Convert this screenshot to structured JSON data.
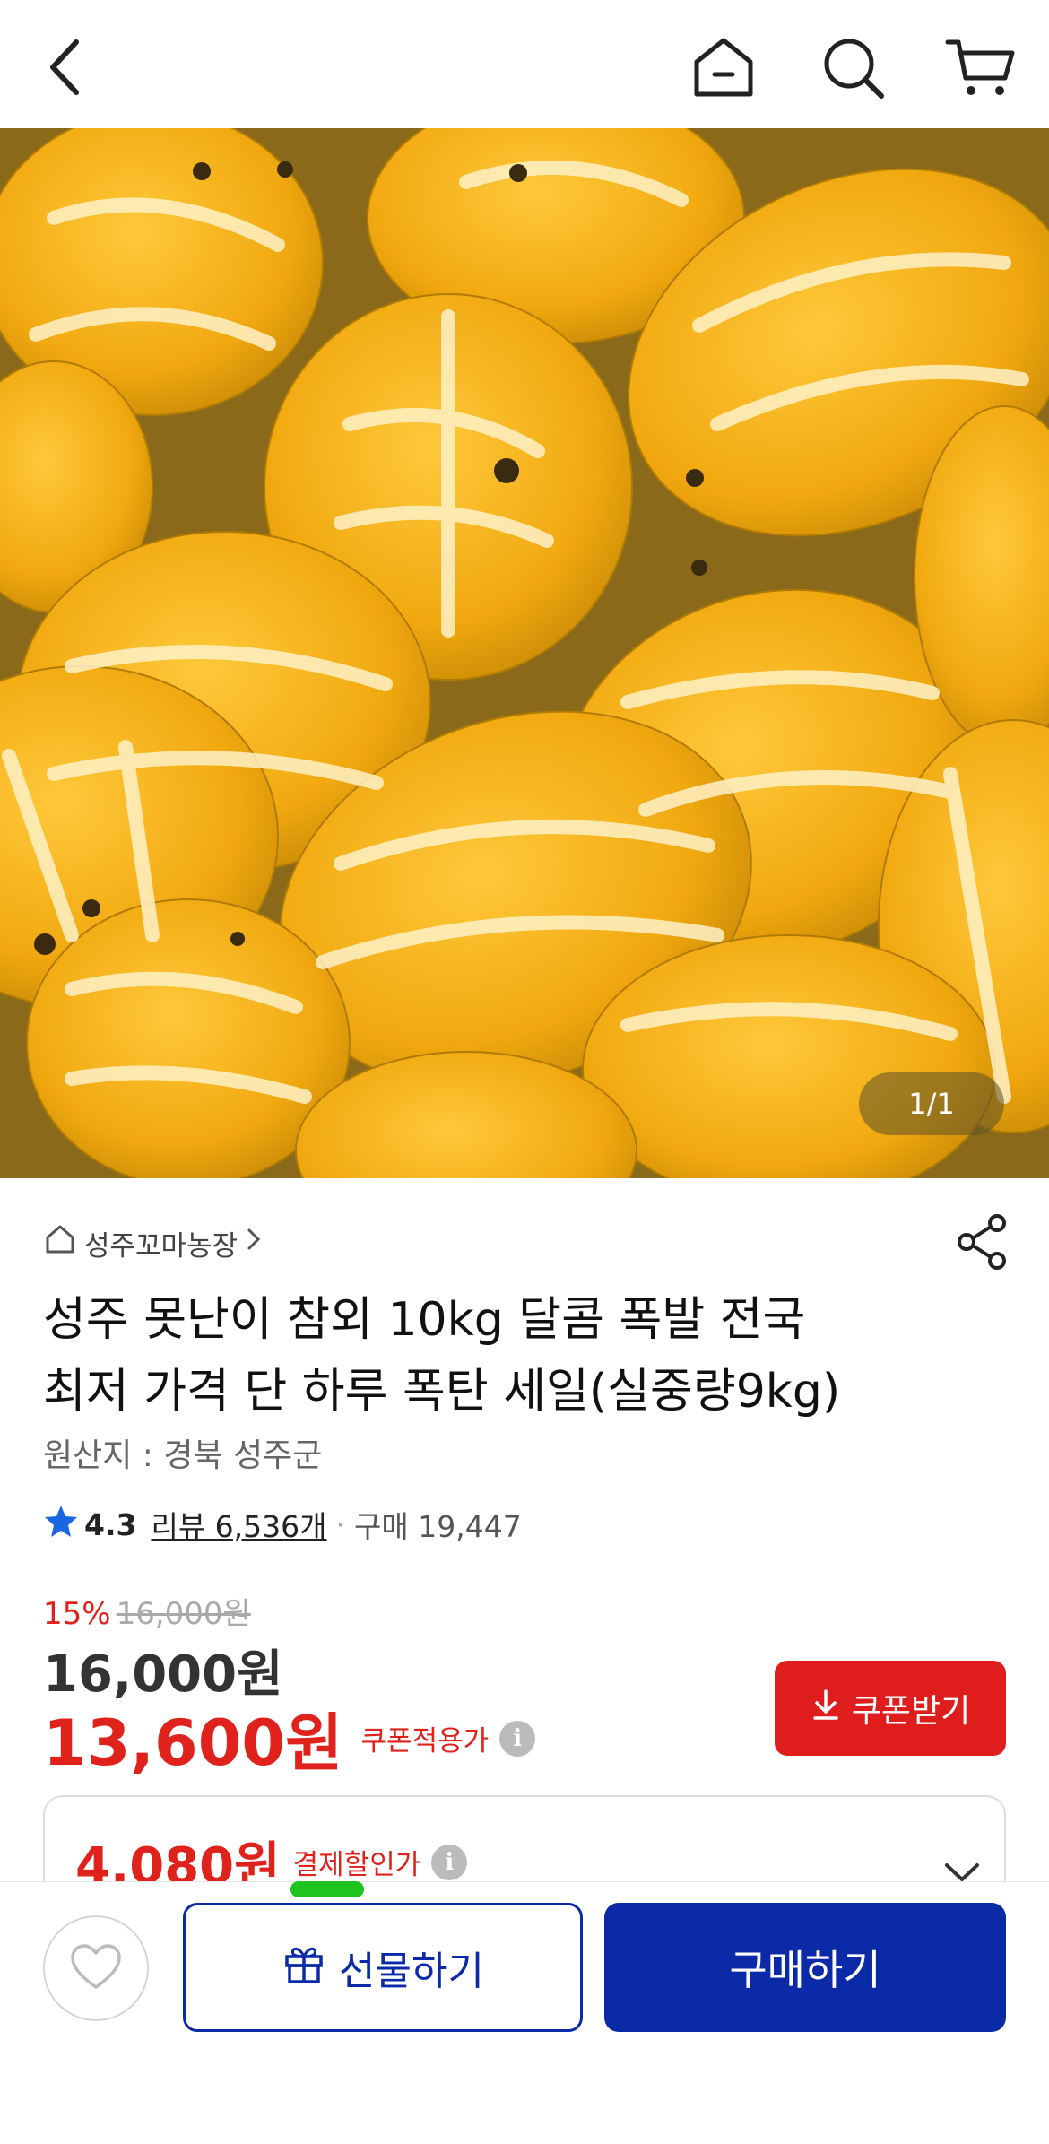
{
  "header": {
    "icons": [
      "back-icon",
      "home-icon",
      "search-icon",
      "cart-icon"
    ]
  },
  "gallery": {
    "page_indicator": "1/1"
  },
  "product": {
    "store_name": "성주꼬마농장",
    "title_line1": "성주 못난이 참외  10kg 달콤 폭발 전국",
    "title_line2": "최저 가격 단 하루 폭탄 세일(실중량9kg)",
    "origin": "원산지 : 경북 성주군",
    "rating": "4.3",
    "reviews": "리뷰 6,536개",
    "purchases": "구매 19,447"
  },
  "pricing": {
    "discount_rate": "15%",
    "original_price": "16,000원",
    "price": "16,000원",
    "coupon_price": "13,600원",
    "coupon_price_label": "쿠폰적용가",
    "coupon_button": "쿠폰받기",
    "payment_discount_price": "4,080원",
    "payment_discount_label": "결제할인가"
  },
  "bottom_bar": {
    "gift_button": "선물하기",
    "buy_button": "구매하기"
  },
  "colors": {
    "accent_red": "#e0221c",
    "primary_blue": "#0a2aa8",
    "melon_yellow": "#f4b21b"
  }
}
